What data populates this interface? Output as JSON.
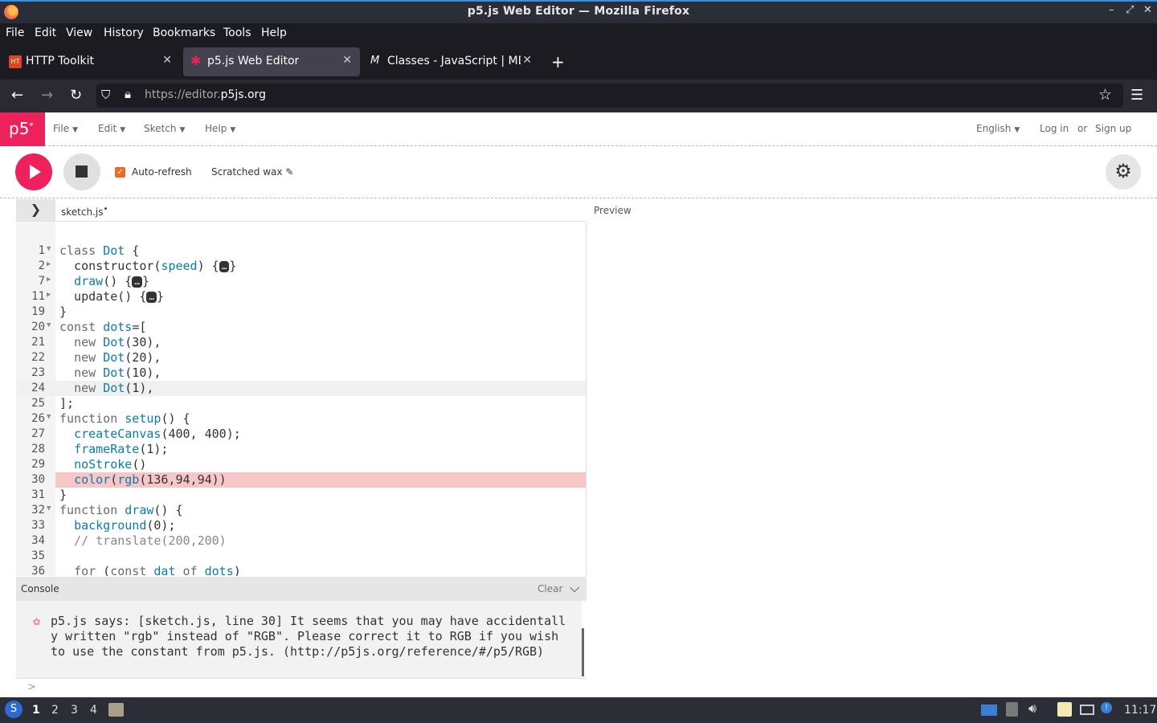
{
  "window": {
    "title": "p5.js Web Editor — Mozilla Firefox"
  },
  "menubar": [
    "File",
    "Edit",
    "View",
    "History",
    "Bookmarks",
    "Tools",
    "Help"
  ],
  "tabs": [
    {
      "label": "HTTP Toolkit",
      "icon": "http-toolkit-icon"
    },
    {
      "label": "p5.js Web Editor",
      "icon": "p5-star-icon",
      "active": true
    },
    {
      "label": "Classes - JavaScript | MDN",
      "icon": "mdn-icon"
    }
  ],
  "url": {
    "prefix": "https://editor.",
    "domain": "p5js.org"
  },
  "p5header": {
    "logo": "p5",
    "menus": [
      "File",
      "Edit",
      "Sketch",
      "Help"
    ],
    "language": "English",
    "login": "Log in",
    "or": "or",
    "signup": "Sign up"
  },
  "toolbar": {
    "auto_refresh_label": "Auto-refresh",
    "auto_refresh_checked": true,
    "sketch_name": "Scratched wax"
  },
  "files": {
    "current": "sketch.js",
    "unsaved_dot": "•"
  },
  "preview_label": "Preview",
  "editor": {
    "lines": [
      {
        "n": "1",
        "fold": "▼",
        "code": "class Dot {"
      },
      {
        "n": "2",
        "fold": "▶",
        "code": "  constructor(speed) {…}"
      },
      {
        "n": "7",
        "fold": "▶",
        "code": "  draw() {…}"
      },
      {
        "n": "11",
        "fold": "▶",
        "code": "  update() {…}"
      },
      {
        "n": "19",
        "fold": "",
        "code": "}"
      },
      {
        "n": "20",
        "fold": "▼",
        "code": "const dots=["
      },
      {
        "n": "21",
        "fold": "",
        "code": "  new Dot(30),"
      },
      {
        "n": "22",
        "fold": "",
        "code": "  new Dot(20),"
      },
      {
        "n": "23",
        "fold": "",
        "code": "  new Dot(10),"
      },
      {
        "n": "24",
        "fold": "",
        "code": "  new Dot(1),"
      },
      {
        "n": "25",
        "fold": "",
        "code": "];"
      },
      {
        "n": "26",
        "fold": "▼",
        "code": "function setup() {"
      },
      {
        "n": "27",
        "fold": "",
        "code": "  createCanvas(400, 400);"
      },
      {
        "n": "28",
        "fold": "",
        "code": "  frameRate(1);"
      },
      {
        "n": "29",
        "fold": "",
        "code": "  noStroke()"
      },
      {
        "n": "30",
        "fold": "",
        "code": "  color(rgb(136,94,94))"
      },
      {
        "n": "31",
        "fold": "",
        "code": "}"
      },
      {
        "n": "32",
        "fold": "▼",
        "code": "function draw() {"
      },
      {
        "n": "33",
        "fold": "",
        "code": "  background(0);"
      },
      {
        "n": "34",
        "fold": "",
        "code": "  // translate(200,200)"
      },
      {
        "n": "35",
        "fold": "",
        "code": ""
      },
      {
        "n": "36",
        "fold": "",
        "code": "  for (const dat of dots)"
      }
    ],
    "highlight_line": "24",
    "error_line": "30"
  },
  "console": {
    "title": "Console",
    "clear": "Clear",
    "message": "p5.js says: [sketch.js, line 30] It seems that you may have accidentally written \"rgb\" instead of \"RGB\". Please correct it to RGB if you wish to use the constant from p5.js. (http://p5js.org/reference/#/p5/RGB)",
    "prompt": ">"
  },
  "taskbar": {
    "workspaces": [
      "1",
      "2",
      "3",
      "4"
    ],
    "clock": "11:17"
  },
  "colors": {
    "p5_pink": "#ed225d",
    "error_bg": "#f7c6c6",
    "accent_orange": "#ed6a22"
  }
}
